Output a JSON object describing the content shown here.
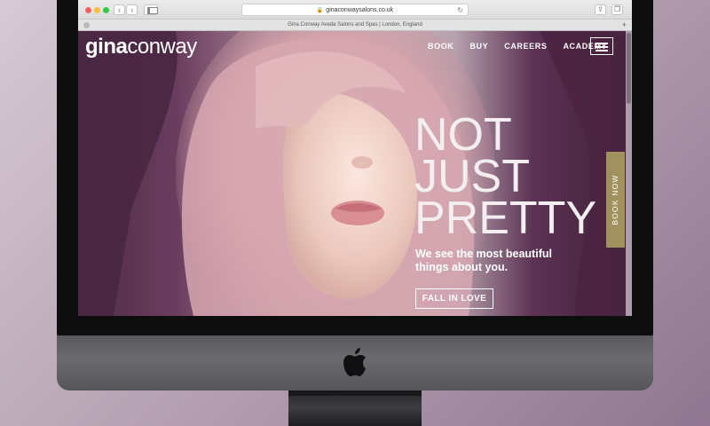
{
  "browser": {
    "url": "ginaconwaysalons.co.uk",
    "tab_title": "Gina Conway Aveda Salons and Spas | London, England",
    "back_icon": "‹",
    "forward_icon": "›",
    "reload_icon": "↻",
    "share_icon": "⇪",
    "tabs_icon": "❐",
    "newtab_icon": "+"
  },
  "site": {
    "logo_first": "gina",
    "logo_second": "conway",
    "nav": [
      "BOOK",
      "BUY",
      "CAREERS",
      "ACADEMY"
    ]
  },
  "hero": {
    "headline_line1": "NOT",
    "headline_line2": "JUST",
    "headline_line3": "PRETTY",
    "subtitle": "We see the most beautiful things about you.",
    "cta_label": "FALL IN LOVE",
    "book_now_label": "BOOK NOW"
  },
  "colors": {
    "book_tab": "#a0915d",
    "accent_purple": "#5c3354"
  }
}
